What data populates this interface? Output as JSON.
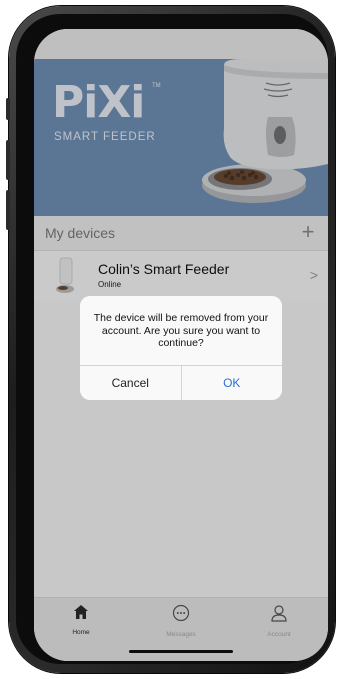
{
  "banner": {
    "brand": "PiXi",
    "trademark": "TM",
    "subtitle": "SMART FEEDER"
  },
  "devices_section": {
    "title": "My devices",
    "add_label": "+"
  },
  "device": {
    "name": "Colin’s Smart Feeder",
    "status": "Online",
    "chevron": ">"
  },
  "alert": {
    "message": "The device will be removed from your account. Are you sure you want to continue?",
    "cancel_label": "Cancel",
    "ok_label": "OK"
  },
  "tabbar": {
    "tabs": [
      {
        "label": "Home",
        "icon": "home-icon",
        "active": true
      },
      {
        "label": "Messages",
        "icon": "chat-bubble-icon",
        "active": false
      },
      {
        "label": "Account",
        "icon": "person-icon",
        "active": false
      }
    ]
  },
  "colors": {
    "banner": "#6f8fb5",
    "ok_button": "#2a6fd6"
  }
}
